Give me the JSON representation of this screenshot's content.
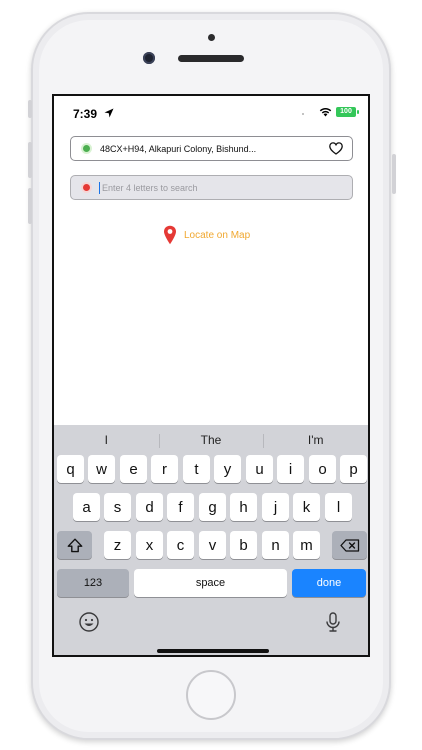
{
  "status_bar": {
    "time": "7:39",
    "battery": "100"
  },
  "trip": {
    "from_address": "48CX+H94, Alkapuri Colony, Bishund...",
    "to_placeholder": "Enter 4 letters to search",
    "to_value": "",
    "locate_label": "Locate on Map"
  },
  "keyboard": {
    "suggestions": [
      "I",
      "The",
      "I'm"
    ],
    "row1": [
      "q",
      "w",
      "e",
      "r",
      "t",
      "y",
      "u",
      "i",
      "o",
      "p"
    ],
    "row2": [
      "a",
      "s",
      "d",
      "f",
      "g",
      "h",
      "j",
      "k",
      "l"
    ],
    "row3": [
      "z",
      "x",
      "c",
      "v",
      "b",
      "n",
      "m"
    ],
    "numbers_label": "123",
    "space_label": "space",
    "done_label": "done"
  },
  "colors": {
    "from_dot": "#4caf50",
    "to_dot": "#e53935",
    "locate_text": "#f0a830",
    "pin": "#e53935",
    "done_key": "#1a84ff",
    "battery": "#34c759"
  },
  "icons": [
    "location-arrow-icon",
    "wifi-icon",
    "battery-icon",
    "heart-icon",
    "map-pin-icon",
    "shift-icon",
    "backspace-icon",
    "emoji-icon",
    "microphone-icon"
  ]
}
